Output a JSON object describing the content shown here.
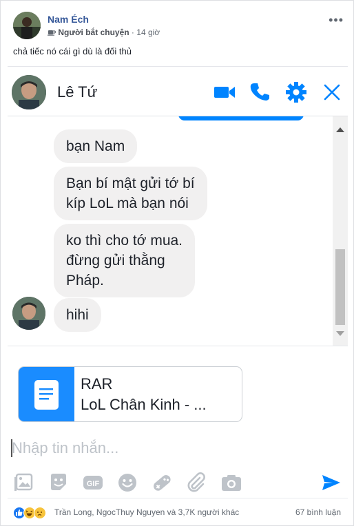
{
  "post": {
    "author": "Nam Éch",
    "role": "Người bắt chuyện",
    "time_sep": "·",
    "time": "14 giờ",
    "text": "chả tiếc nó cái gì dù là đối thủ",
    "more": "•••"
  },
  "chat": {
    "contact_name": "Lê Tứ",
    "header_icons": [
      "video-camera-icon",
      "phone-icon",
      "gear-icon",
      "close-icon"
    ],
    "accent_color": "#0084ff",
    "messages": [
      {
        "text": "bạn Nam"
      },
      {
        "lines": [
          "Bạn bí mật gửi tớ bí",
          "kíp LoL mà bạn nói"
        ]
      },
      {
        "lines": [
          "ko thì cho tớ mua.",
          "đừng gửi thằng",
          "Pháp."
        ]
      },
      {
        "text": "hihi"
      }
    ],
    "attachment": {
      "type": "RAR",
      "name": "LoL Chân Kinh - ..."
    },
    "input_placeholder": "Nhập tin nhắn...",
    "toolbar_icons": [
      "image-icon",
      "sticker-icon",
      "gif-icon",
      "emoji-icon",
      "game-icon",
      "paperclip-icon",
      "camera-icon",
      "send-icon"
    ]
  },
  "footer": {
    "reactions": [
      "like-icon",
      "haha-icon",
      "sad-icon"
    ],
    "reactors_text": "Trần Long, NgocThuy Nguyen và 3,7K người khác",
    "comments": "67 bình luận"
  }
}
